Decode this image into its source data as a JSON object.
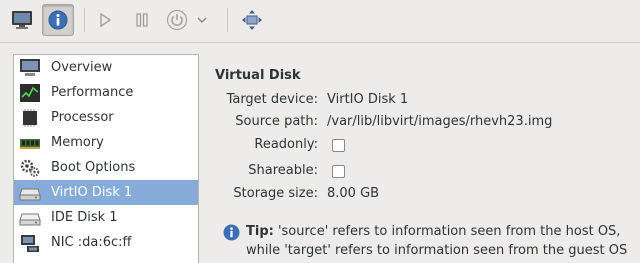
{
  "toolbar": {
    "buttons": [
      {
        "name": "console-view-button",
        "icon": "monitor-icon"
      },
      {
        "name": "details-view-button",
        "icon": "info-icon",
        "active": true
      },
      {
        "name": "run-button",
        "icon": "play-icon"
      },
      {
        "name": "pause-button",
        "icon": "pause-icon"
      },
      {
        "name": "shutdown-button",
        "icon": "power-icon"
      },
      {
        "name": "shutdown-menu-button",
        "icon": "chevron-down-icon"
      },
      {
        "name": "fullscreen-button",
        "icon": "fullscreen-icon"
      }
    ]
  },
  "sidebar": {
    "items": [
      {
        "label": "Overview",
        "icon": "monitor-icon"
      },
      {
        "label": "Performance",
        "icon": "performance-graph-icon"
      },
      {
        "label": "Processor",
        "icon": "processor-chip-icon"
      },
      {
        "label": "Memory",
        "icon": "memory-module-icon"
      },
      {
        "label": "Boot Options",
        "icon": "gears-icon"
      },
      {
        "label": "VirtIO Disk 1",
        "icon": "disk-drive-icon",
        "selected": true
      },
      {
        "label": "IDE Disk 1",
        "icon": "disk-drive-icon"
      },
      {
        "label": "NIC :da:6c:ff",
        "icon": "network-card-icon"
      }
    ]
  },
  "detail": {
    "title": "Virtual Disk",
    "target_device_label": "Target device:",
    "target_device_value": "VirtIO Disk 1",
    "source_path_label": "Source path:",
    "source_path_value": "/var/lib/libvirt/images/rhevh23.img",
    "readonly_label": "Readonly:",
    "readonly_checked": false,
    "shareable_label": "Shareable:",
    "shareable_checked": false,
    "storage_size_label": "Storage size:",
    "storage_size_value": "8.00 GB"
  },
  "tip": {
    "bold": "Tip:",
    "line1": " 'source' refers to information seen from the host OS,",
    "line2": "while 'target' refers to information seen from the guest OS"
  },
  "colors": {
    "selection": "#86abd9",
    "toolbar_bg": "#edeceb",
    "info_blue": "#3d6fb6"
  }
}
